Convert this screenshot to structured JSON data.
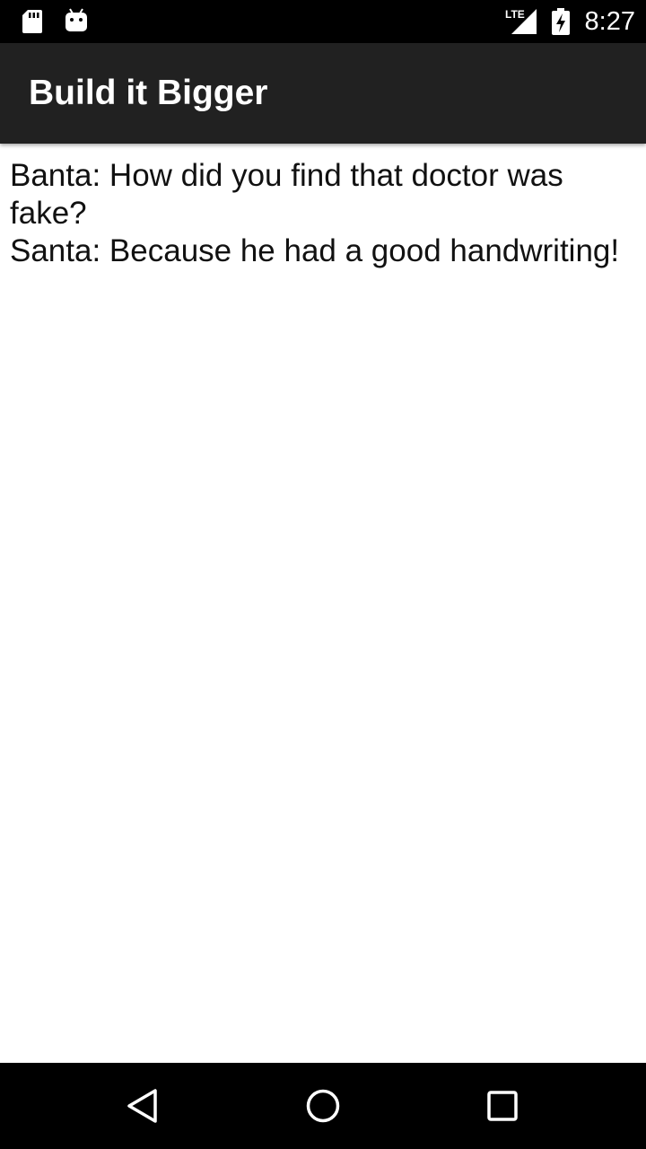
{
  "status_bar": {
    "time": "8:27",
    "network_label": "LTE",
    "icons": [
      "sd-card-icon",
      "android-notification-icon",
      "lte-signal-icon",
      "battery-charging-icon"
    ]
  },
  "app_bar": {
    "title": "Build it Bigger",
    "background": "#212121"
  },
  "joke": {
    "line1": "Banta: How did you find that doctor was fake?",
    "line2": "Santa: Because he had a good handwriting!"
  },
  "nav_bar": {
    "icons": [
      "back-icon",
      "home-icon",
      "recents-icon"
    ]
  }
}
